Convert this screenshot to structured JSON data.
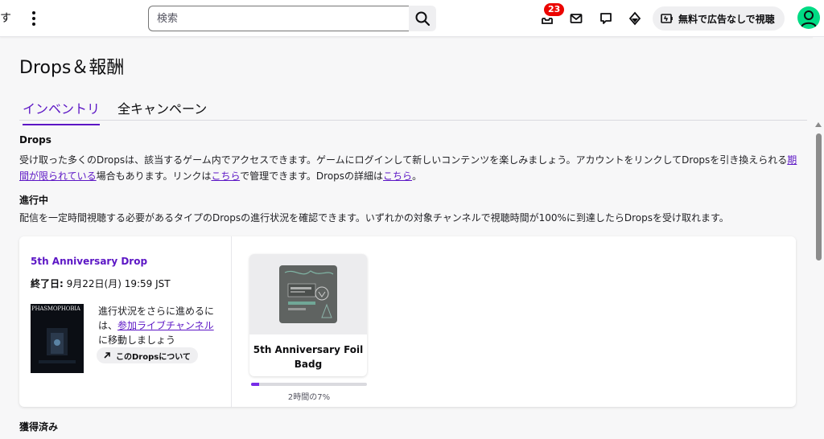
{
  "topbar": {
    "edge_text": "す",
    "search_placeholder": "検索",
    "inbox_count": "23",
    "turbo_label": "無料で広告なしで視聴"
  },
  "page": {
    "title": "Drops＆報酬",
    "tabs": [
      {
        "label": "インベントリ",
        "active": true
      },
      {
        "label": "全キャンペーン",
        "active": false
      }
    ]
  },
  "drops_section": {
    "title": "Drops",
    "text_1": "受け取った多くのDropsは、該当するゲーム内でアクセスできます。ゲームにログインして新しいコンテンツを楽しみましょう。アカウントをリンクしてDropsを引き換えられる",
    "link_1": "期間が限られている",
    "text_2": "場合もあります。リンクは",
    "link_2": "こちら",
    "text_3": "で管理できます。Dropsの詳細は",
    "link_3": "こちら",
    "text_4": "。"
  },
  "in_progress": {
    "title": "進行中",
    "description": "配信を一定時間視聴する必要があるタイプのDropsの進行状況を確認できます。いずれかの対象チャンネルで視聴時間が100%に到達したらDropsを受け取れます。"
  },
  "campaign": {
    "name": "5th Anniversary Drop",
    "end_label": "終了日:",
    "end_value": " 9月22日(月) 19:59 JST",
    "boxart_title": "PHASMOPHOBIA",
    "progress_text_1": "進行状況をさらに進めるには、",
    "progress_link": "参加ライブチャンネル",
    "progress_text_2": "に移動しましょう",
    "about_label": "このDropsについて",
    "reward": {
      "name": "5th Anniversary Foil Badg",
      "progress_percent": 7,
      "progress_label": "2時間の7%"
    }
  },
  "earned": {
    "title": "獲得済み"
  },
  "colors": {
    "accent": "#5c16c5",
    "progress": "#772ce8",
    "badge": "#eb0400",
    "avatar": "#00db84"
  },
  "icons": [
    "more-vertical-icon",
    "search-icon",
    "inbox-icon",
    "mail-icon",
    "chat-icon",
    "crown-icon",
    "turbo-icon",
    "avatar-icon",
    "arrow-up-right-icon"
  ]
}
